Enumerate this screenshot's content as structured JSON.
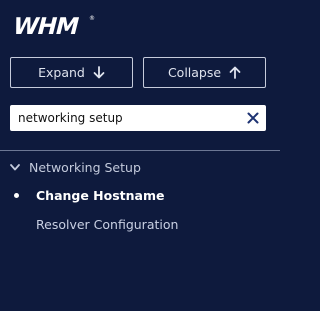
{
  "logo": {
    "text": "WHM",
    "trademark": "®",
    "color": "#ffffff"
  },
  "toolbar": {
    "expand_label": "Expand",
    "collapse_label": "Collapse"
  },
  "search": {
    "value": "networking setup",
    "placeholder": ""
  },
  "nav": {
    "section_label": "Networking Setup",
    "items": [
      {
        "label": "Change Hostname",
        "active": true
      },
      {
        "label": "Resolver Configuration",
        "active": false
      }
    ]
  },
  "colors": {
    "background": "#0e1a3d",
    "text": "#c9d0e3",
    "active_text": "#ffffff",
    "clear_icon": "#1d3272"
  }
}
